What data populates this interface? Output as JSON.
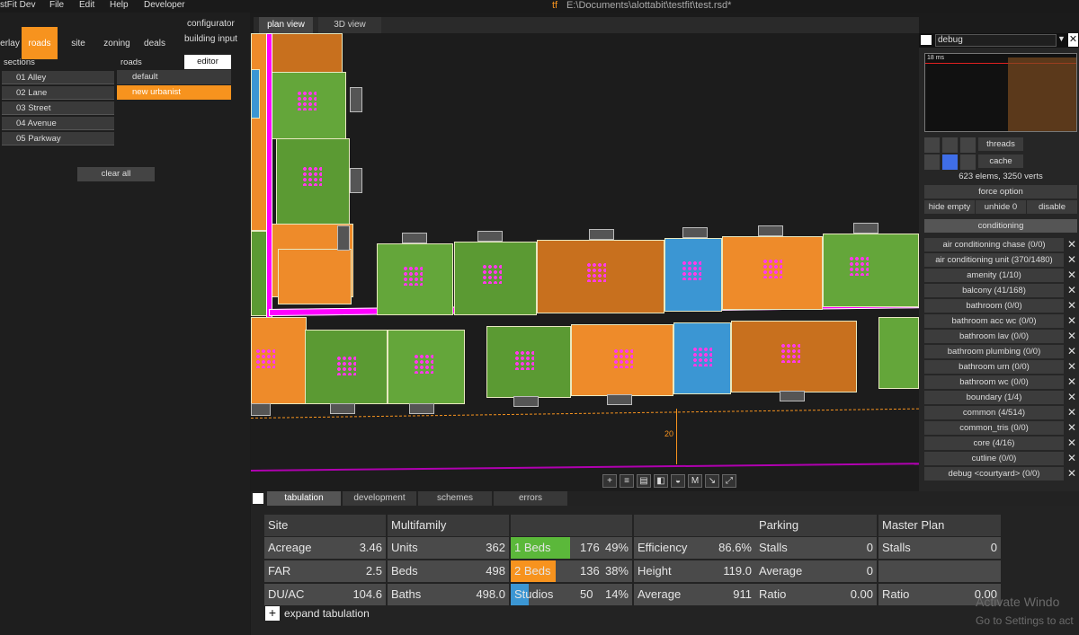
{
  "menubar": {
    "app": "stFit Dev",
    "items": [
      "File",
      "Edit",
      "Help",
      "Developer"
    ],
    "title": "E:\\Documents\\alottabit\\testfit\\test.rsd*"
  },
  "left": {
    "tabs": [
      "erlay",
      "roads",
      "site",
      "zoning",
      "deals"
    ],
    "configurator": "configurator",
    "building_input": "building input",
    "sections_label": "sections",
    "roads_label": "roads",
    "editor_label": "editor",
    "sections": [
      "01 Alley",
      "02 Lane",
      "03 Street",
      "04 Avenue",
      "05 Parkway"
    ],
    "roads": [
      "default",
      "new urbanist"
    ],
    "clear_all": "clear all"
  },
  "viewport": {
    "tabs": [
      "plan view",
      "3D view"
    ],
    "dimension": "20",
    "tools": [
      "+",
      "≡",
      "▤",
      "◧",
      "◒",
      "M",
      "↘",
      "⤢"
    ]
  },
  "debug": {
    "title": "debug",
    "graph_label": "18 ms",
    "threads": "threads",
    "cache": "cache",
    "stats": "623 elems, 3250 verts",
    "force_option": "force option",
    "hide_empty": "hide empty",
    "unhide": "unhide 0",
    "disable": "disable",
    "conditioning": "conditioning",
    "items": [
      "air conditioning chase (0/0)",
      "air conditioning unit (370/1480)",
      "amenity (1/10)",
      "balcony (41/168)",
      "bathroom (0/0)",
      "bathroom acc wc (0/0)",
      "bathroom lav (0/0)",
      "bathroom plumbing (0/0)",
      "bathroom urn (0/0)",
      "bathroom wc (0/0)",
      "boundary (1/4)",
      "common (4/514)",
      "common_tris (0/0)",
      "core (4/16)",
      "cutline (0/0)",
      "debug <courtyard> (0/0)"
    ]
  },
  "bottom": {
    "tabs": [
      "tabulation",
      "development",
      "schemes",
      "errors"
    ],
    "headers": {
      "site": "Site",
      "multifamily": "Multifamily",
      "parking": "Parking",
      "master": "Master Plan"
    },
    "site": [
      {
        "label": "Acreage",
        "value": "3.46"
      },
      {
        "label": "FAR",
        "value": "2.5"
      },
      {
        "label": "DU/AC",
        "value": "104.6"
      }
    ],
    "multifamily": [
      {
        "label": "Units",
        "value": "362"
      },
      {
        "label": "Beds",
        "value": "498"
      },
      {
        "label": "Baths",
        "value": "498.0"
      }
    ],
    "unit_mix": [
      {
        "label": "1 Beds",
        "count": "176",
        "pct": "49%",
        "color": "#5bb83a"
      },
      {
        "label": "2 Beds",
        "count": "136",
        "pct": "38%",
        "color": "#f7931e"
      },
      {
        "label": "Studios",
        "count": "50",
        "pct": "14%",
        "color": "#3b96d3"
      }
    ],
    "efficiency": [
      {
        "label": "Efficiency",
        "value": "86.6%"
      },
      {
        "label": "Height",
        "value": "119.0"
      },
      {
        "label": "Average",
        "value": "911"
      }
    ],
    "parking": [
      {
        "label": "Stalls",
        "value": "0"
      },
      {
        "label": "Average",
        "value": "0"
      },
      {
        "label": "Ratio",
        "value": "0.00"
      }
    ],
    "master": [
      {
        "label": "Stalls",
        "value": "0"
      },
      {
        "label": "",
        "value": ""
      },
      {
        "label": "Ratio",
        "value": "0.00"
      }
    ],
    "expand": "expand tabulation"
  },
  "watermark": {
    "line1": "Activate Windo",
    "line2": "Go to Settings to act"
  },
  "colors": {
    "accent": "#f7931e",
    "road": "#ff00ff",
    "green": "#5b9a33",
    "blue": "#3b96d3"
  }
}
